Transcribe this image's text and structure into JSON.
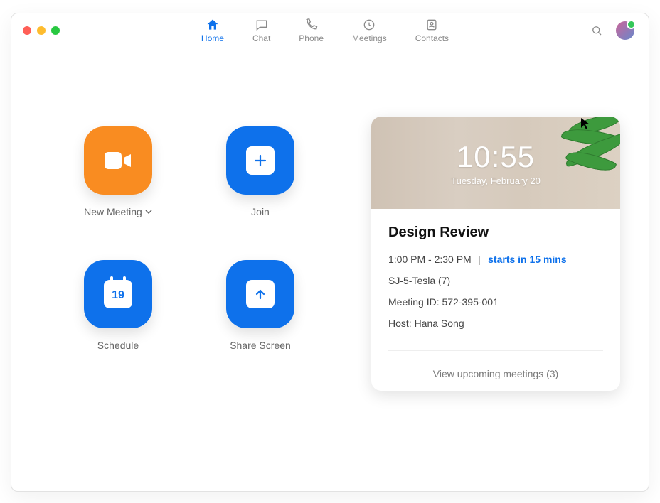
{
  "tabs": {
    "home": "Home",
    "chat": "Chat",
    "phone": "Phone",
    "meetings": "Meetings",
    "contacts": "Contacts"
  },
  "tiles": {
    "new_meeting": "New Meeting",
    "join": "Join",
    "schedule": "Schedule",
    "schedule_day": "19",
    "share_screen": "Share Screen"
  },
  "card": {
    "time": "10:55",
    "date": "Tuesday, February 20",
    "event_title": "Design Review",
    "time_range": "1:00 PM - 2:30 PM",
    "starts_in": "starts in 15 mins",
    "room": "SJ-5-Tesla (7)",
    "meeting_id": "Meeting ID: 572-395-001",
    "host": "Host: Hana Song",
    "upcoming": "View upcoming meetings (3)"
  }
}
